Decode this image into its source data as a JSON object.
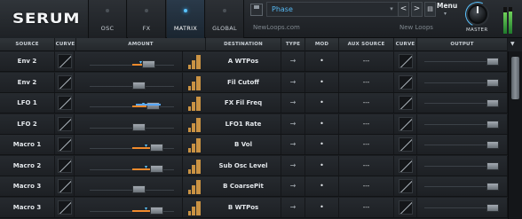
{
  "app": {
    "logo": "SERUM"
  },
  "tabs": [
    {
      "label": "OSC",
      "active": false
    },
    {
      "label": "FX",
      "active": false
    },
    {
      "label": "MATRIX",
      "active": true
    },
    {
      "label": "GLOBAL",
      "active": false
    }
  ],
  "preset": {
    "name": "Phase",
    "author": "NewLoops.com",
    "bank": "New Loops",
    "prev": "<",
    "next": ">",
    "menu": "Menu"
  },
  "master": {
    "label": "MASTER",
    "meter_left": 0.8,
    "meter_right": 0.85
  },
  "columns": [
    "SOURCE",
    "CURVE",
    "AMOUNT",
    "DESTINATION",
    "TYPE",
    "MOD",
    "AUX SOURCE",
    "CURVE",
    "OUTPUT"
  ],
  "rows": [
    {
      "source": "Env 2",
      "dest": "A WTPos",
      "type": "→",
      "mod": "•",
      "aux": "---",
      "amount": 0.25,
      "bipolar": false
    },
    {
      "source": "Env 2",
      "dest": "Fil Cutoff",
      "type": "→",
      "mod": "•",
      "aux": "---",
      "amount": 0.0,
      "bipolar": false
    },
    {
      "source": "LFO 1",
      "dest": "FX Fil Freq",
      "type": "→",
      "mod": "•",
      "aux": "---",
      "amount": 0.35,
      "bipolar": false
    },
    {
      "source": "LFO 2",
      "dest": "LFO1 Rate",
      "type": "→",
      "mod": "•",
      "aux": "---",
      "amount": 0.0,
      "bipolar": false
    },
    {
      "source": "Macro 1",
      "dest": "B Vol",
      "type": "→",
      "mod": "•",
      "aux": "---",
      "amount": 0.45,
      "bipolar": false
    },
    {
      "source": "Macro 2",
      "dest": "Sub Osc Level",
      "type": "→",
      "mod": "•",
      "aux": "---",
      "amount": 0.45,
      "bipolar": false
    },
    {
      "source": "Macro 3",
      "dest": "B CoarsePit",
      "type": "→",
      "mod": "•",
      "aux": "---",
      "amount": 0.0,
      "bipolar": false
    },
    {
      "source": "Macro 3",
      "dest": "B WTPos",
      "type": "→",
      "mod": "•",
      "aux": "---",
      "amount": 0.45,
      "bipolar": false
    }
  ],
  "colors": {
    "accent": "#59c3ff",
    "amount_fill": "#f08a2c",
    "preset_text": "#56b8f2"
  }
}
